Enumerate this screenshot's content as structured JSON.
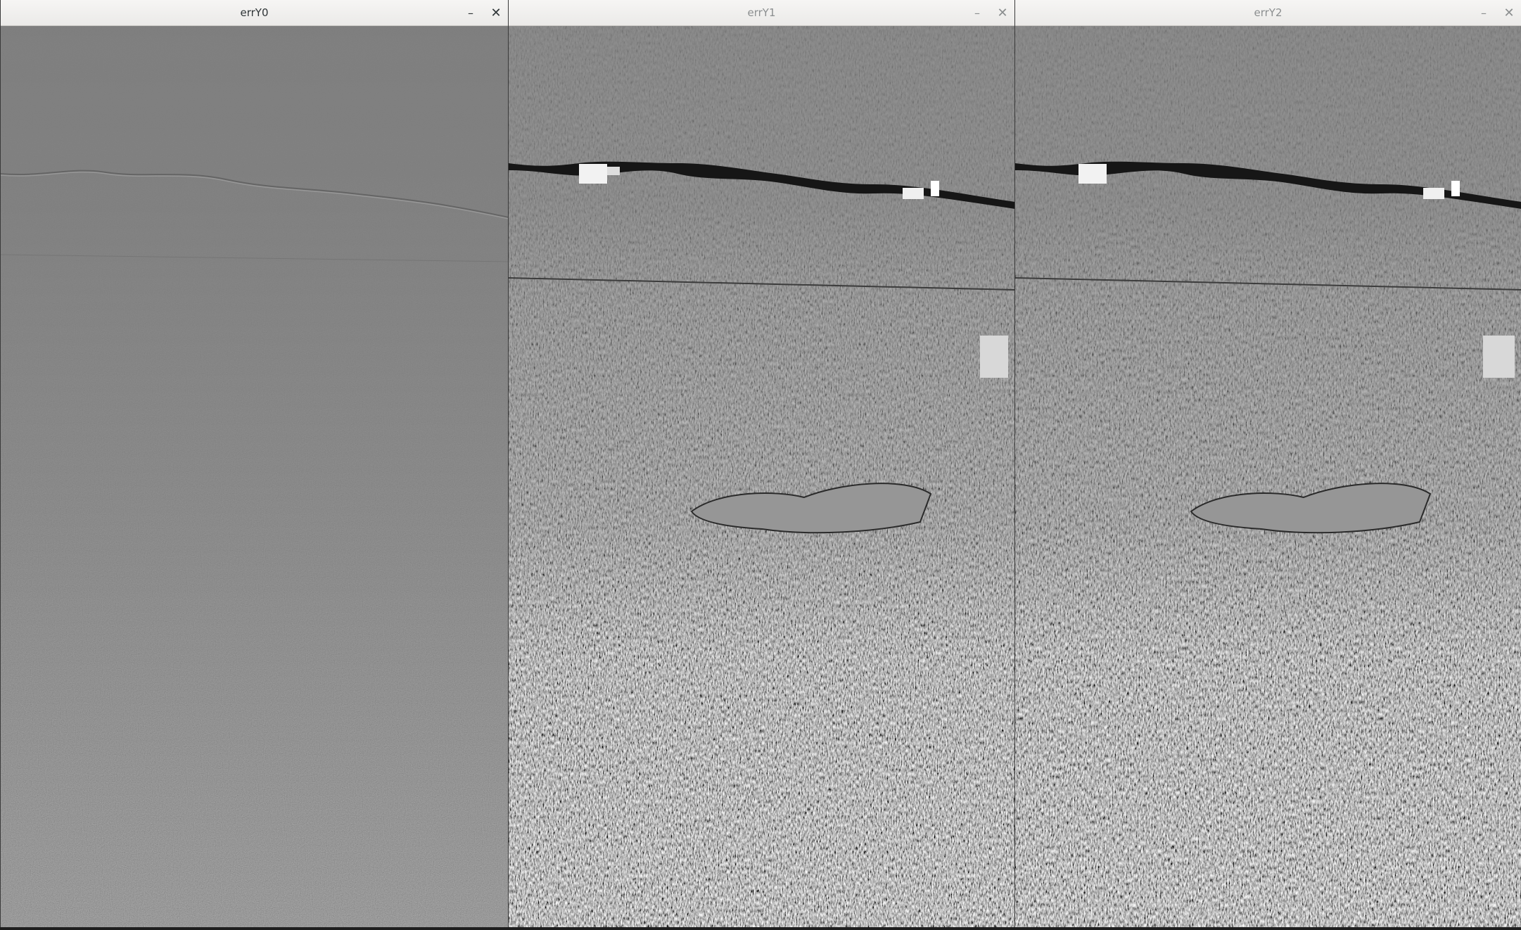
{
  "windows": [
    {
      "title": "errY0",
      "active": true
    },
    {
      "title": "errY1",
      "active": false
    },
    {
      "title": "errY2",
      "active": false
    }
  ],
  "controls": {
    "minimize_glyph": "–",
    "close_glyph": "✕"
  },
  "colors": {
    "image_mid_gray": "#7e7e7e",
    "titlebar_bg": "#f1f0ee"
  }
}
